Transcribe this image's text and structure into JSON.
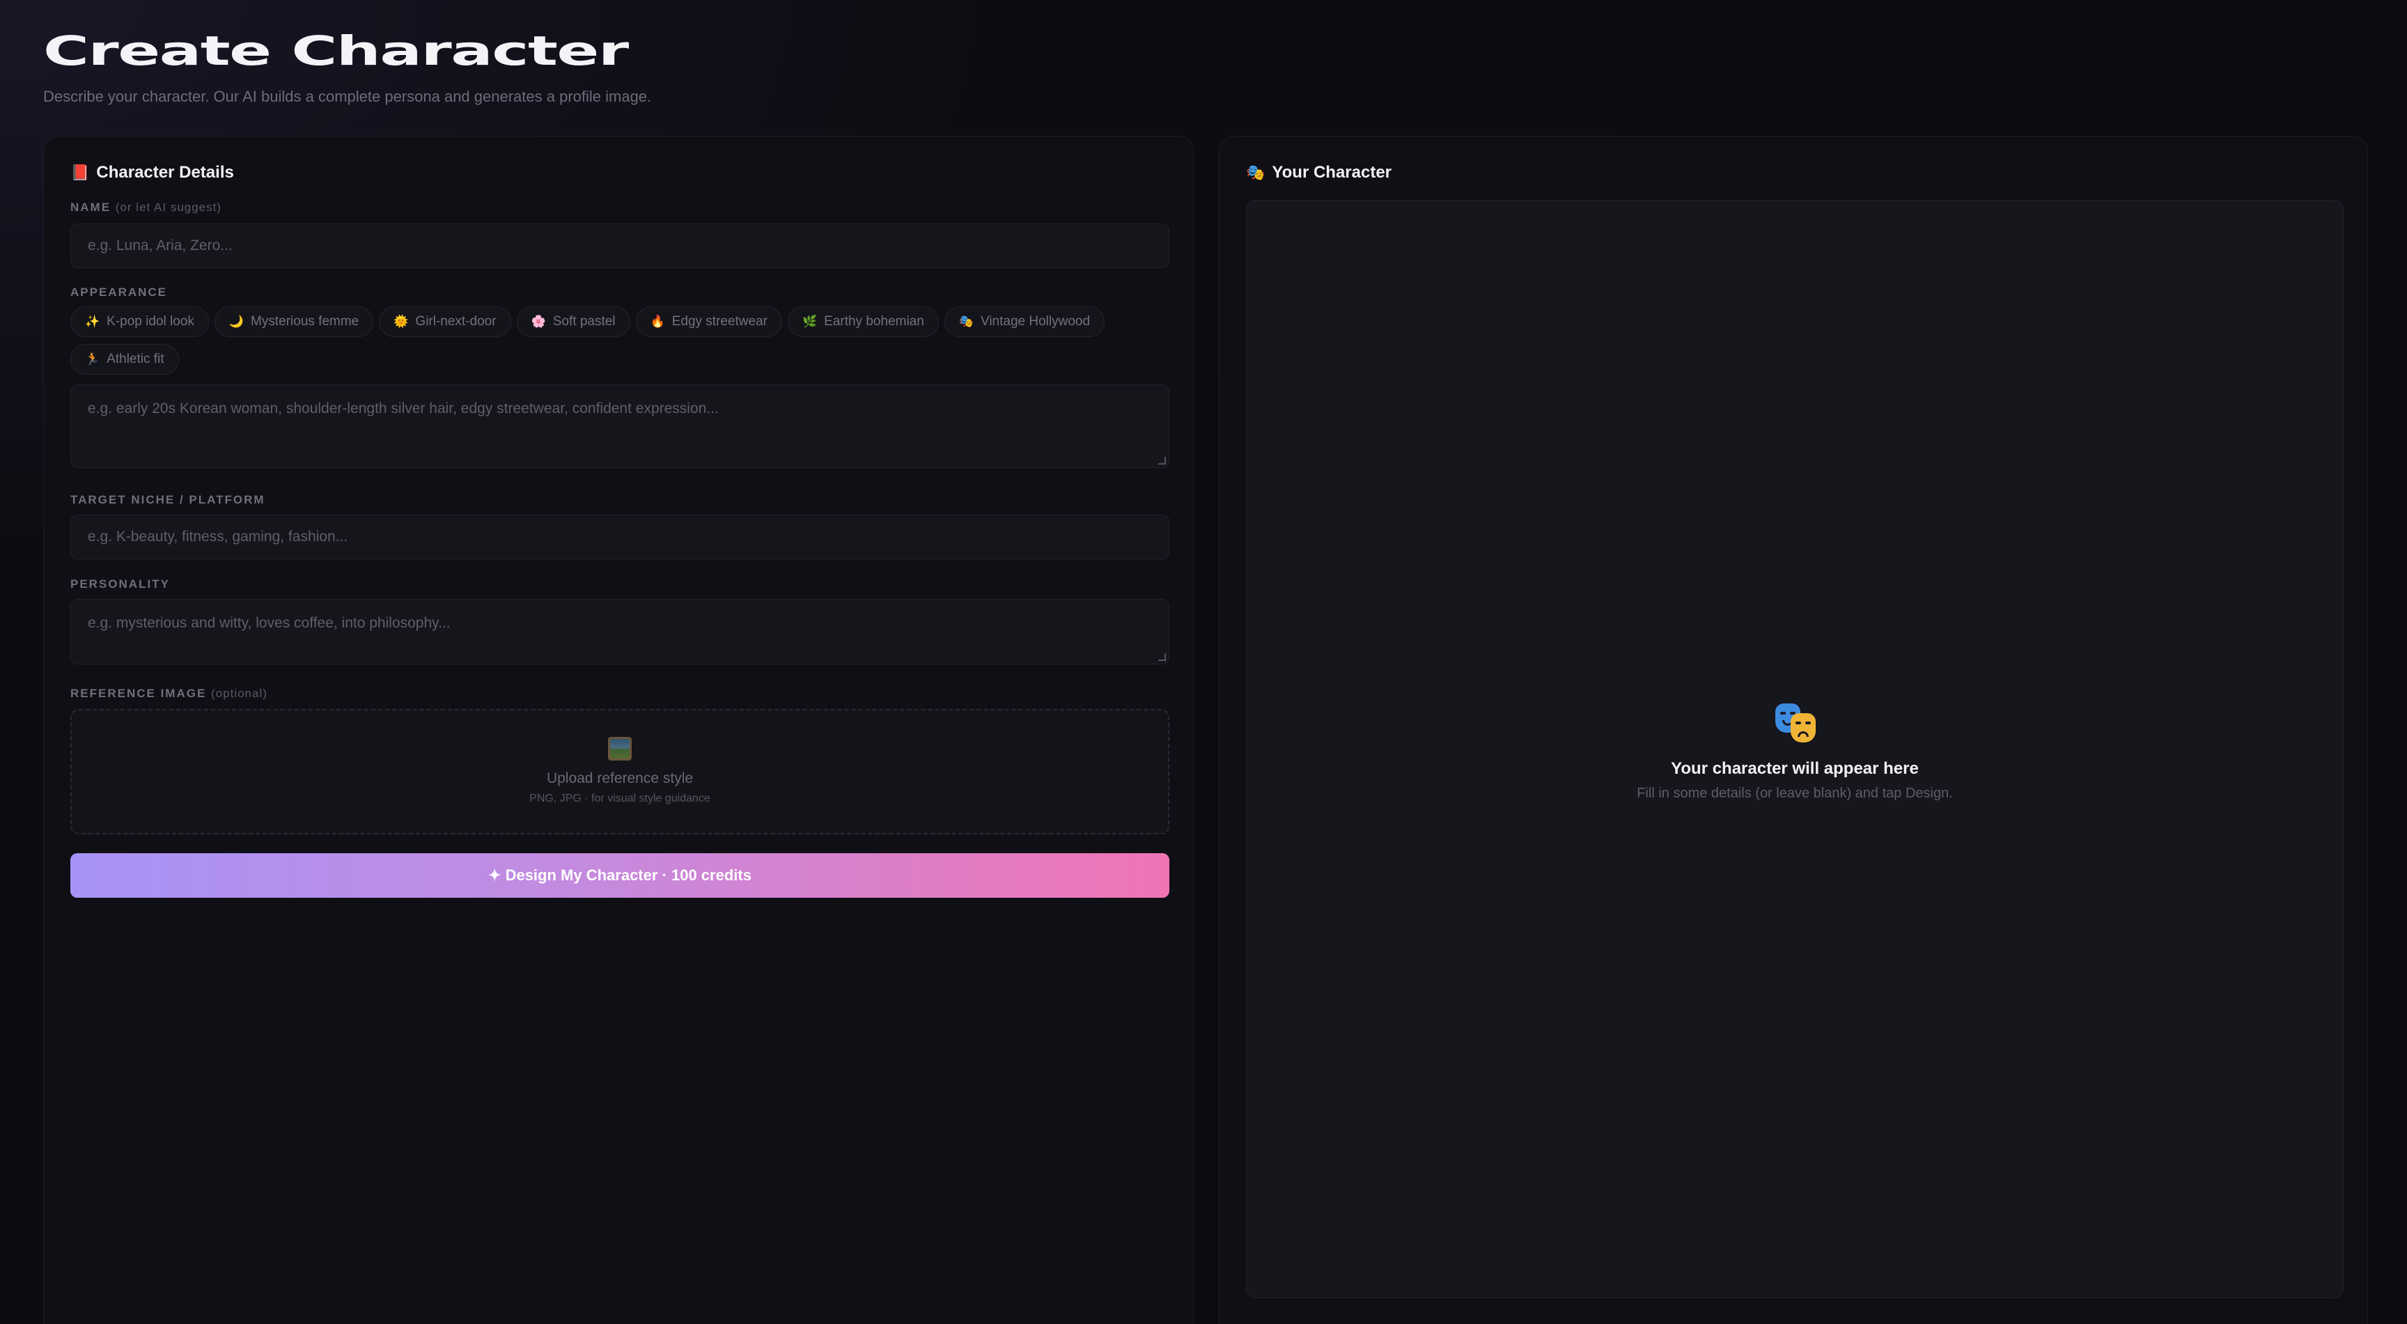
{
  "header": {
    "title": "Create Character",
    "subtitle": "Describe your character. Our AI builds a complete persona and generates a profile image."
  },
  "details_panel": {
    "title": "Character Details",
    "title_icon": "📕",
    "name_field": {
      "label": "NAME",
      "hint": "(or let AI suggest)",
      "placeholder": "e.g. Luna, Aria, Zero...",
      "value": ""
    },
    "appearance": {
      "label": "APPEARANCE",
      "presets": [
        {
          "icon": "✨",
          "label": "K-pop idol look"
        },
        {
          "icon": "🌙",
          "label": "Mysterious femme"
        },
        {
          "icon": "🌞",
          "label": "Girl-next-door"
        },
        {
          "icon": "🌸",
          "label": "Soft pastel"
        },
        {
          "icon": "🔥",
          "label": "Edgy streetwear"
        },
        {
          "icon": "🌿",
          "label": "Earthy bohemian"
        },
        {
          "icon": "🎭",
          "label": "Vintage Hollywood"
        },
        {
          "icon": "🏃",
          "label": "Athletic fit"
        }
      ],
      "placeholder": "e.g. early 20s Korean woman, shoulder-length silver hair, edgy streetwear, confident expression...",
      "value": ""
    },
    "niche_field": {
      "label": "TARGET NICHE / PLATFORM",
      "placeholder": "e.g. K-beauty, fitness, gaming, fashion...",
      "value": ""
    },
    "personality_field": {
      "label": "PERSONALITY",
      "placeholder": "e.g. mysterious and witty, loves coffee, into philosophy...",
      "value": ""
    },
    "reference_image": {
      "label": "REFERENCE IMAGE",
      "hint": "(optional)",
      "upload_title": "Upload reference style",
      "upload_sub": "PNG, JPG · for visual style guidance",
      "icon": "image-icon"
    },
    "submit_label": "✦ Design My Character · 100 credits"
  },
  "preview_panel": {
    "title": "Your Character",
    "title_icon": "🎭",
    "empty_icon": "theater-masks-icon",
    "empty_title": "Your character will appear here",
    "empty_sub": "Fill in some details (or leave blank) and tap Design."
  },
  "colors": {
    "background": "#0b0b10",
    "panel": "#0f0f15",
    "button_gradient_start": "#a793f6",
    "button_gradient_end": "#f074b4"
  }
}
